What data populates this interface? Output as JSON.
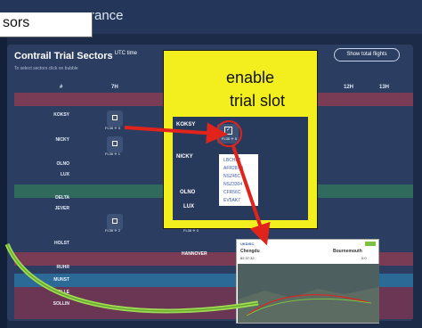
{
  "top_callout": "sors",
  "topbar": {
    "brand": "rance"
  },
  "panel": {
    "title": "Contrail Trial Sectors",
    "title_sup": "UTC time",
    "subtitle": "To select sectors click on bubble",
    "show_button": "Show total flights",
    "columns": {
      "hash": "#",
      "c7": "7H",
      "c12": "12H",
      "c13": "13H"
    },
    "rows": [
      "KOKSY",
      "NICKY",
      "OLNO",
      "LUX",
      "DELTA",
      "JEVER",
      "HOLST",
      "RUHR",
      "MUNST",
      "CELLE",
      "SOLLIN"
    ],
    "hannover": "HANNOVER",
    "fl_koksy": "FL36 ✈ 5",
    "fl_nicky": "FL36 ✈ 1",
    "fl_jever": "FL36 ✈ 2",
    "fl_jever2": "FL36 ✈ 0"
  },
  "callout": {
    "line1": "enable",
    "line2": "trial slot",
    "labels": [
      "KOKSY",
      "NICKY",
      "OLNO",
      "LUX"
    ],
    "selected_fl": "FL36 ✈ 5",
    "check": "✓",
    "dropdown": [
      "LBCHB2",
      "AFR28XB",
      "NSZ45C",
      "NSZ3304",
      "CFR56C",
      "EV5AK7"
    ]
  },
  "screenshot": {
    "brand": "UKDISC",
    "origin": "Chengdu",
    "destination": "Bournemouth",
    "row1": "82:37:32",
    "row2": "0:0"
  },
  "colors": {
    "bg": "#1c2b47",
    "panel": "#2b3e61",
    "callout": "#f3ef1e",
    "arrow": "#e0241c",
    "green_curve": "#9edc53"
  }
}
